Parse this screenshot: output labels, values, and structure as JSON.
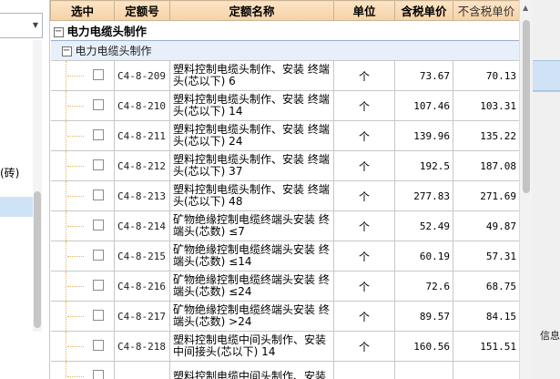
{
  "left_panel": {
    "tree_text": "(砖)"
  },
  "table": {
    "headers": {
      "select": "选中",
      "code": "定额号",
      "name": "定额名称",
      "unit": "单位",
      "price_tax": "含税单价",
      "price_notax": "不含税单价"
    },
    "group": {
      "toggle": "−",
      "title": "电力电缆头制作"
    },
    "subgroup": {
      "toggle": "−",
      "title": "电力电缆头制作"
    },
    "rows": [
      {
        "code": "C4-8-209",
        "name": "塑料控制电缆头制作、安装 终端头(芯以下) 6",
        "unit": "个",
        "price_tax": "73.67",
        "price_notax": "70.13"
      },
      {
        "code": "C4-8-210",
        "name": "塑料控制电缆头制作、安装 终端头(芯以下) 14",
        "unit": "个",
        "price_tax": "107.46",
        "price_notax": "103.31"
      },
      {
        "code": "C4-8-211",
        "name": "塑料控制电缆头制作、安装 终端头(芯以下) 24",
        "unit": "个",
        "price_tax": "139.96",
        "price_notax": "135.22"
      },
      {
        "code": "C4-8-212",
        "name": "塑料控制电缆头制作、安装 终端头(芯以下) 37",
        "unit": "个",
        "price_tax": "192.5",
        "price_notax": "187.08"
      },
      {
        "code": "C4-8-213",
        "name": "塑料控制电缆头制作、安装 终端头(芯以下) 48",
        "unit": "个",
        "price_tax": "277.83",
        "price_notax": "271.69"
      },
      {
        "code": "C4-8-214",
        "name": "矿物绝缘控制电缆终端头安装 终端头(芯数) ≤7",
        "unit": "个",
        "price_tax": "52.49",
        "price_notax": "49.87"
      },
      {
        "code": "C4-8-215",
        "name": "矿物绝缘控制电缆终端头安装 终端头(芯数) ≤14",
        "unit": "个",
        "price_tax": "60.19",
        "price_notax": "57.31"
      },
      {
        "code": "C4-8-216",
        "name": "矿物绝缘控制电缆终端头安装 终端头(芯数) ≤24",
        "unit": "个",
        "price_tax": "72.6",
        "price_notax": "68.75"
      },
      {
        "code": "C4-8-217",
        "name": "矿物绝缘控制电缆终端头安装 终端头(芯数) >24",
        "unit": "个",
        "price_tax": "89.57",
        "price_notax": "84.15"
      },
      {
        "code": "C4-8-218",
        "name": "塑料控制电缆中间头制作、安装 中间接头(芯以下) 14",
        "unit": "个",
        "price_tax": "160.56",
        "price_notax": "151.51"
      },
      {
        "code": "",
        "name": "塑料控制电缆中间头制作、安装",
        "unit": "",
        "price_tax": "",
        "price_notax": ""
      }
    ]
  },
  "right_panel": {
    "info_label": "信息"
  },
  "colors": {
    "header_bg": "#f6d2a6",
    "subgroup_bg": "#e7effa",
    "selection_blue": "#cfe2f6"
  }
}
